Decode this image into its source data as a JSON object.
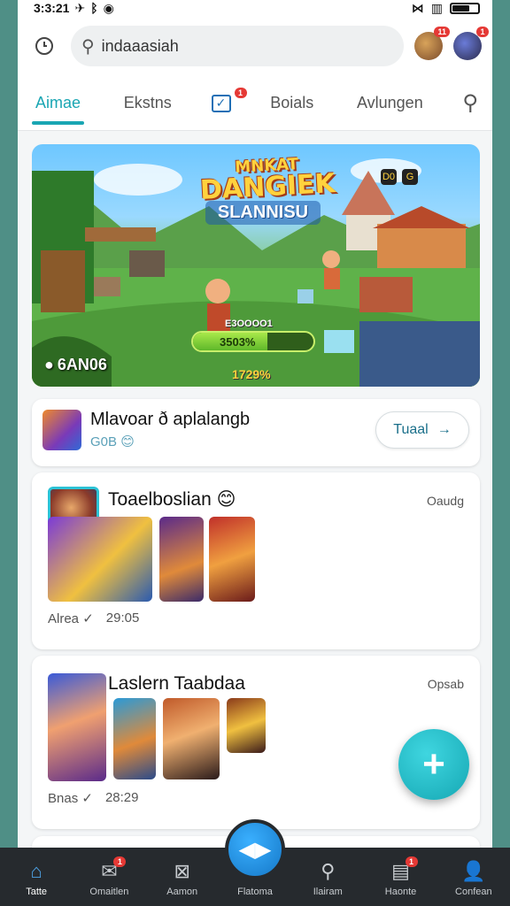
{
  "status_bar": {
    "time": "3:3:21",
    "left_icons": [
      "notification-icon",
      "bluetooth-icon",
      "game-icon"
    ],
    "right_icons": [
      "signal-icon",
      "wifi-icon",
      "battery-icon"
    ],
    "battery_level": 0.7
  },
  "top_bar": {
    "search_text": "indaaasiah",
    "notif_badge": "11",
    "profile_badge": "1"
  },
  "tabs": [
    {
      "label": "Aimae",
      "active": true
    },
    {
      "label": "Ekstns",
      "active": false
    },
    {
      "label": "",
      "badge": "1",
      "icon": "checkbox-icon",
      "active": false
    },
    {
      "label": "Boials",
      "active": false
    },
    {
      "label": "Avlungen",
      "active": false
    }
  ],
  "hero": {
    "title_line1": "DANGIEK",
    "title_top": "MNKAT",
    "title_line2": "SLANNISU",
    "small_label": "E3OOOO1",
    "bar_label": "3503%",
    "bar_fill": 0.62,
    "players": "6AN06",
    "percent": "1729%",
    "icons": [
      "D0",
      "G"
    ]
  },
  "card1": {
    "title": "Mlavoar ð aplalangb",
    "sub": "G0B",
    "button": "Tuaal"
  },
  "card2": {
    "title": "Toaelboslian",
    "link": "Oaudg",
    "meta_left": "Alrea",
    "meta_time": "29:05"
  },
  "card3": {
    "title": "Laslern Taabdaa",
    "link": "Opsab",
    "meta_left": "Bnas",
    "meta_time": "28:29"
  },
  "fab": {
    "label": "+"
  },
  "bottom_nav": [
    {
      "label": "Tatte",
      "icon": "home-icon",
      "active": true
    },
    {
      "label": "Omaitlen",
      "icon": "chat-icon",
      "badge": "1",
      "active": false
    },
    {
      "label": "Aamon",
      "icon": "close-box-icon",
      "active": false
    },
    {
      "label": "Flatoma",
      "icon": "play-icon",
      "active": false,
      "center": true
    },
    {
      "label": "Ilairam",
      "icon": "search-icon",
      "active": false
    },
    {
      "label": "Haonte",
      "icon": "inbox-icon",
      "badge": "1",
      "active": false
    },
    {
      "label": "Confean",
      "icon": "profile-icon",
      "active": false
    }
  ],
  "colors": {
    "accent": "#1aa6b3",
    "nav_bg": "#262a2e",
    "fab": "#15a7b3",
    "side_bg": "#4f8f86"
  }
}
